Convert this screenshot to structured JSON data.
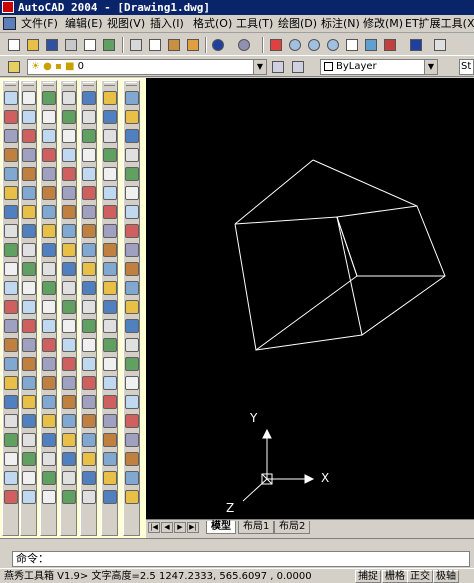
{
  "window": {
    "title": "AutoCAD 2004 - [Drawing1.dwg]"
  },
  "menu": [
    "文件(F)",
    "编辑(E)",
    "视图(V)",
    "插入(I)",
    "格式(O)",
    "工具(T)",
    "绘图(D)",
    "标注(N)",
    "修改(M)",
    "ET扩展工具(X)"
  ],
  "layer_toolbar": {
    "layer_value": "0",
    "color_value": "ByLayer",
    "style_value": "St"
  },
  "layout_tabs": [
    "模型",
    "布局1",
    "布局2"
  ],
  "command": {
    "prompt": "命令："
  },
  "status": {
    "text": "燕秀工具箱 V1.9> 文字高度=2.5",
    "coords": "1247.2333, 565.6097 , 0.0000",
    "buttons": [
      "捕捉",
      "栅格",
      "正交",
      "极轴"
    ]
  },
  "ucs": {
    "x_label": "X",
    "y_label": "Y",
    "z_label": "Z"
  },
  "colors": {
    "titlebar": "#0a246a",
    "canvas": "#000000",
    "panel": "#ffffd6",
    "chrome": "#d4d0c8"
  }
}
